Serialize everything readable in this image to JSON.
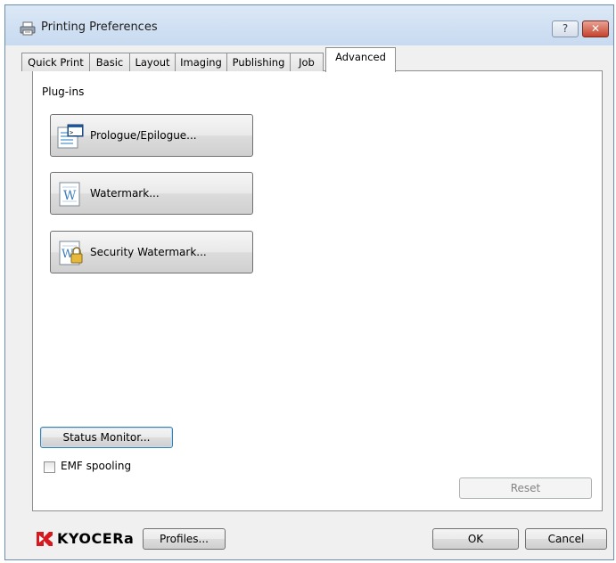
{
  "window": {
    "title": "Printing Preferences",
    "help_label": "?",
    "close_label": "✕"
  },
  "tabs": [
    {
      "label": "Quick Print"
    },
    {
      "label": "Basic"
    },
    {
      "label": "Layout"
    },
    {
      "label": "Imaging"
    },
    {
      "label": "Publishing"
    },
    {
      "label": "Job"
    },
    {
      "label": "Advanced",
      "active": true
    }
  ],
  "panel": {
    "section_label": "Plug-ins",
    "plugins": [
      {
        "label": "Prologue/Epilogue...",
        "icon": "prologue-epilogue-icon"
      },
      {
        "label": "Watermark...",
        "icon": "watermark-icon"
      },
      {
        "label": "Security Watermark...",
        "icon": "security-watermark-icon"
      }
    ],
    "status_monitor_label": "Status Monitor...",
    "emf_spooling_label": "EMF spooling",
    "emf_spooling_checked": false,
    "reset_label": "Reset"
  },
  "footer": {
    "logo_text": "KYOCERa",
    "profiles_label": "Profiles...",
    "ok_label": "OK",
    "cancel_label": "Cancel"
  },
  "colors": {
    "logo_red": "#d7191f",
    "titlebar": "#c8daf0",
    "close_red": "#c5432c"
  }
}
